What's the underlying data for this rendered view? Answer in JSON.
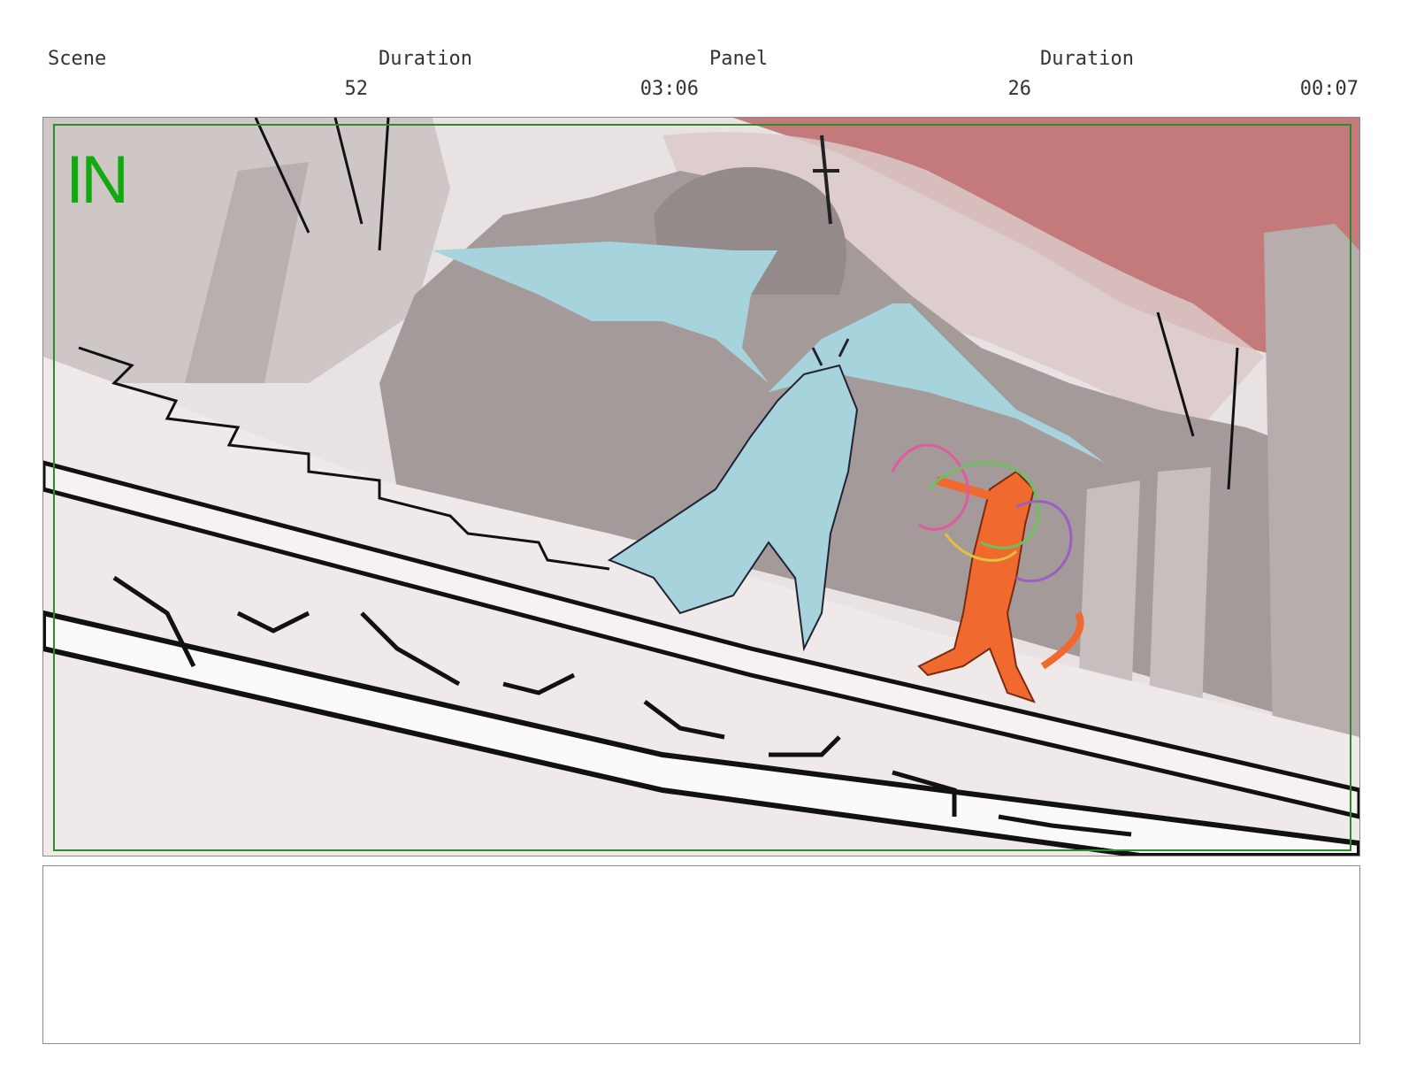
{
  "header": {
    "scene_label": "Scene",
    "scene_duration_label": "Duration",
    "panel_label": "Panel",
    "panel_duration_label": "Duration"
  },
  "values": {
    "scene_number": "52",
    "scene_duration": "03:06",
    "panel_number": "26",
    "panel_duration": "00:07"
  },
  "panel": {
    "transition_mark": "IN",
    "colors": {
      "sky_red": "#c47a7a",
      "wall_gray": "#a59a9a",
      "floor": "#efe9e9",
      "demon_cyan": "#a6d3dc",
      "imp_orange": "#f06a30",
      "safe_frame_green": "#2d8a2d"
    }
  },
  "notes": {
    "text": ""
  }
}
